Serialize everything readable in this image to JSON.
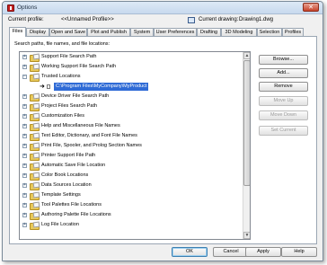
{
  "window": {
    "title": "Options",
    "close_label": "✕"
  },
  "profile": {
    "label": "Current profile:",
    "value": "<<Unnamed Profile>>"
  },
  "drawing": {
    "label": "Current drawing:",
    "value": "Drawing1.dwg"
  },
  "tabs": [
    "Files",
    "Display",
    "Open and Save",
    "Plot and Publish",
    "System",
    "User Preferences",
    "Drafting",
    "3D Modeling",
    "Selection",
    "Profiles"
  ],
  "active_tab": "Files",
  "list_caption": "Search paths, file names, and file locations:",
  "tree": [
    {
      "label": "Support File Search Path",
      "expander": "+"
    },
    {
      "label": "Working Support File Search Path",
      "expander": "+"
    },
    {
      "label": "Trusted Locations",
      "expander": "−"
    },
    {
      "label": "C:\\Program Files\\MyCompany\\MyProduct",
      "child": true,
      "selected": true
    },
    {
      "label": "Device Driver File Search Path",
      "expander": "+"
    },
    {
      "label": "Project Files Search Path",
      "expander": "+"
    },
    {
      "label": "Customization Files",
      "expander": "+"
    },
    {
      "label": "Help and Miscellaneous File Names",
      "expander": "+"
    },
    {
      "label": "Text Editor, Dictionary, and Font File Names",
      "expander": "+"
    },
    {
      "label": "Print File, Spooler, and Prolog Section Names",
      "expander": "+"
    },
    {
      "label": "Printer Support File Path",
      "expander": "+"
    },
    {
      "label": "Automatic Save File Location",
      "expander": "+"
    },
    {
      "label": "Color Book Locations",
      "expander": "+"
    },
    {
      "label": "Data Sources Location",
      "expander": "+"
    },
    {
      "label": "Template Settings",
      "expander": "+"
    },
    {
      "label": "Tool Palettes File Locations",
      "expander": "+"
    },
    {
      "label": "Authoring Palette File Locations",
      "expander": "+"
    },
    {
      "label": "Log File Location",
      "expander": "+"
    }
  ],
  "side_buttons": {
    "browse": "Browse...",
    "add": "Add...",
    "remove": "Remove",
    "move_up": "Move Up",
    "move_down": "Move Down",
    "set_current": "Set Current"
  },
  "bottom_buttons": {
    "ok": "OK",
    "cancel": "Cancel",
    "apply": "Apply",
    "help": "Help"
  },
  "colors": {
    "selection": "#2f6bd6",
    "folder": "#e8c95a"
  }
}
